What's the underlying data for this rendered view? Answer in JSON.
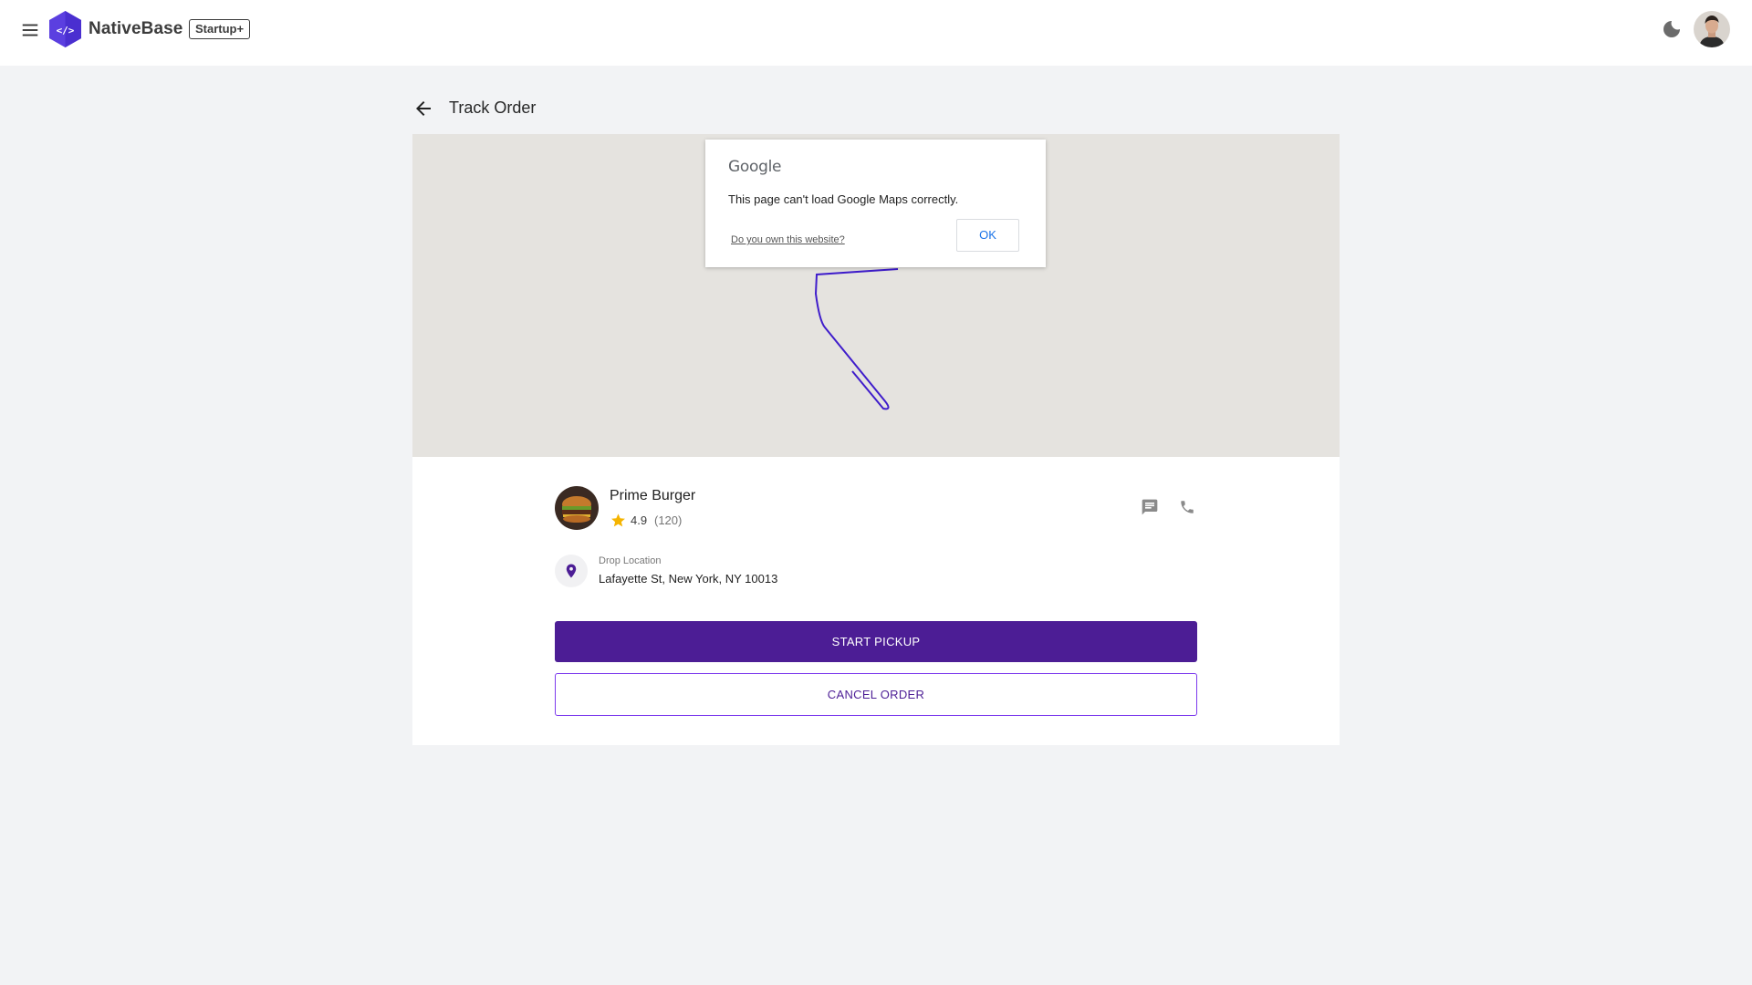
{
  "header": {
    "brand": "NativeBase",
    "badge": "Startup+",
    "icons": [
      "menu-icon",
      "nativebase-logo",
      "moon-icon",
      "user-avatar"
    ]
  },
  "page": {
    "title": "Track Order"
  },
  "map": {
    "dialog": {
      "logo_text": "Google",
      "message": "This page can't load Google Maps correctly.",
      "link": "Do you own this website?",
      "ok_label": "OK"
    },
    "route_color": "#3f1dcb"
  },
  "order": {
    "restaurant": "Prime Burger",
    "rating": "4.9",
    "reviews": "(120)",
    "drop_label": "Drop Location",
    "drop_address": "Lafayette St, New York, NY 10013",
    "start_label": "START PICKUP",
    "cancel_label": "CANCEL ORDER"
  },
  "colors": {
    "accent": "#4c1d95",
    "accent_outline": "#7c3aed",
    "star": "#f5b400",
    "background": "#f2f3f5"
  }
}
